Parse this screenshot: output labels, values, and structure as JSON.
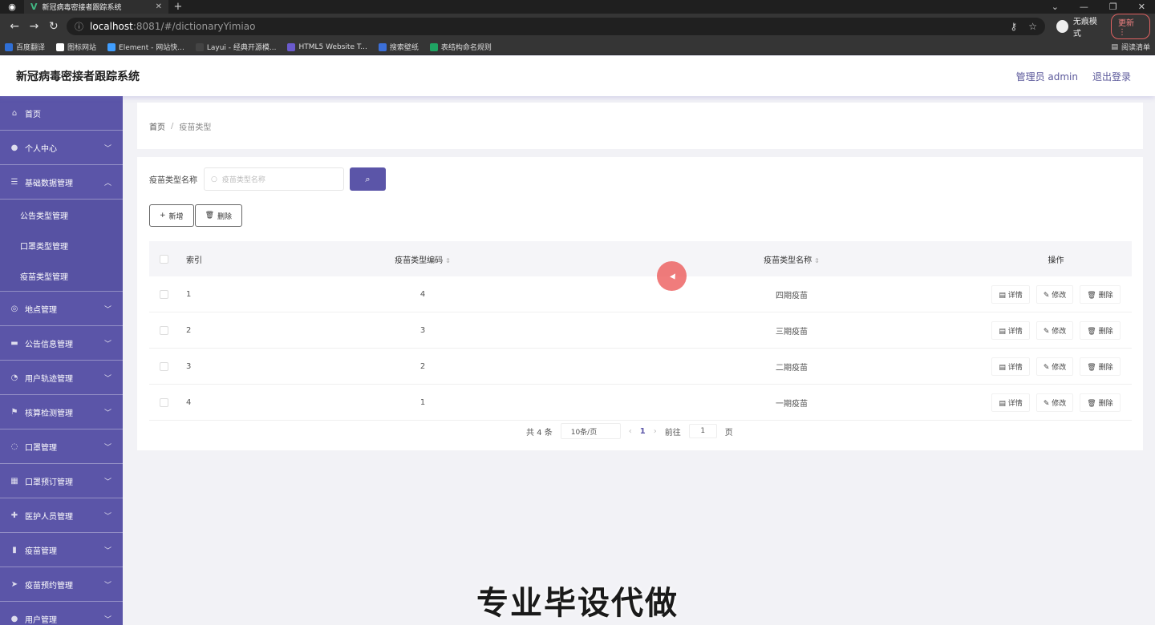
{
  "browser": {
    "tab_title": "新冠病毒密接者跟踪系统",
    "url_host": "localhost",
    "url_path": ":8081/#/dictionaryYimiao",
    "incognito_label": "无痕模式",
    "update_label": "更新",
    "bookmarks": [
      "百度翻译",
      "图标网站",
      "Element - 网站快...",
      "Layui - 经典开源模...",
      "HTML5 Website T...",
      "搜索壁纸",
      "表结构命名规则"
    ],
    "reading_list": "阅读清单"
  },
  "header": {
    "title": "新冠病毒密接者跟踪系统",
    "admin_label": "管理员 admin",
    "logout_label": "退出登录"
  },
  "sidebar": {
    "items": [
      {
        "label": "首页",
        "icon": "home-icon"
      },
      {
        "label": "个人中心",
        "icon": "user-icon"
      },
      {
        "label": "基础数据管理",
        "icon": "list-icon"
      },
      {
        "label": "地点管理",
        "icon": "location-icon"
      },
      {
        "label": "公告信息管理",
        "icon": "notice-icon"
      },
      {
        "label": "用户轨迹管理",
        "icon": "track-icon"
      },
      {
        "label": "核算检测管理",
        "icon": "flag-icon"
      },
      {
        "label": "口罩管理",
        "icon": "mask-icon"
      },
      {
        "label": "口罩预订管理",
        "icon": "order-icon"
      },
      {
        "label": "医护人员管理",
        "icon": "doctor-icon"
      },
      {
        "label": "疫苗管理",
        "icon": "chart-icon"
      },
      {
        "label": "疫苗预约管理",
        "icon": "send-icon"
      },
      {
        "label": "用户管理",
        "icon": "users-icon"
      }
    ],
    "sub_items": [
      "公告类型管理",
      "口罩类型管理",
      "疫苗类型管理"
    ]
  },
  "breadcrumb": {
    "home": "首页",
    "current": "疫苗类型"
  },
  "search": {
    "label": "疫苗类型名称",
    "placeholder": "疫苗类型名称"
  },
  "actions": {
    "add": "新增",
    "delete": "删除"
  },
  "table": {
    "headers": {
      "index": "索引",
      "code": "疫苗类型编码",
      "name": "疫苗类型名称",
      "ops": "操作"
    },
    "rows": [
      {
        "index": "1",
        "code": "4",
        "name": "四期疫苗"
      },
      {
        "index": "2",
        "code": "3",
        "name": "三期疫苗"
      },
      {
        "index": "3",
        "code": "2",
        "name": "二期疫苗"
      },
      {
        "index": "4",
        "code": "1",
        "name": "一期疫苗"
      }
    ],
    "op_labels": {
      "detail": "详情",
      "edit": "修改",
      "remove": "删除"
    }
  },
  "pagination": {
    "total": "共 4 条",
    "page_size": "10条/页",
    "current": "1",
    "goto_label": "前往",
    "goto_value": "1",
    "page_unit": "页"
  },
  "watermark": "专业毕设代做",
  "colors": {
    "accent": "#5b55a8",
    "sidebar": "#5b55a8"
  }
}
